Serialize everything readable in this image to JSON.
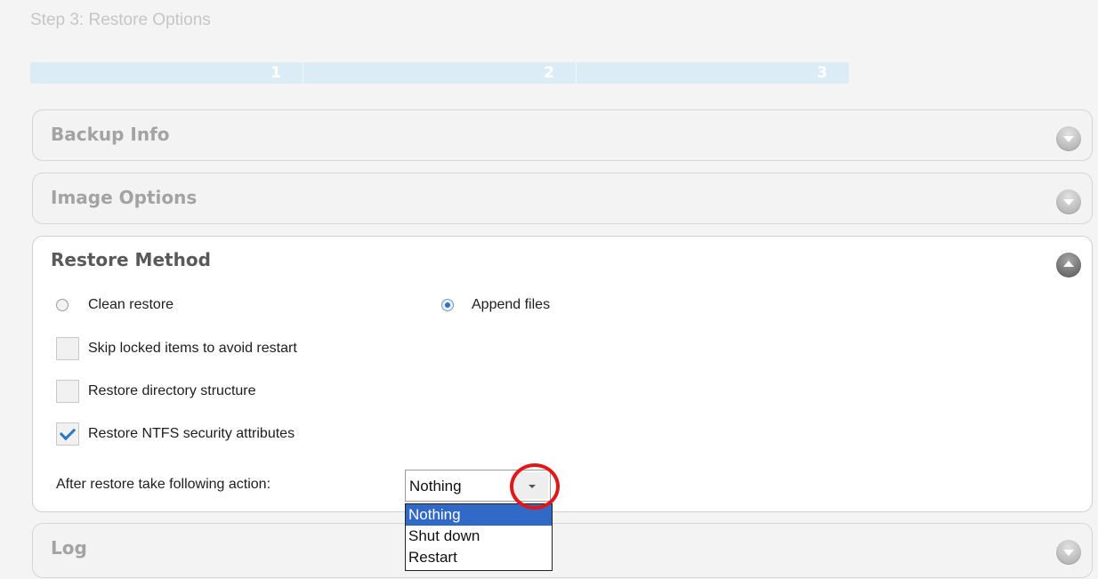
{
  "header": {
    "step_title": "Step 3: Restore Options"
  },
  "progress": {
    "steps": [
      "1",
      "2",
      "3"
    ],
    "current_step": 3
  },
  "panels": {
    "backup_info": {
      "title": "Backup Info",
      "expanded": false
    },
    "image_options": {
      "title": "Image Options",
      "expanded": false
    },
    "restore_method": {
      "title": "Restore Method",
      "expanded": true,
      "restore_mode": {
        "clean_restore_label": "Clean restore",
        "append_files_label": "Append files",
        "selected": "Append files"
      },
      "options": [
        {
          "label": "Skip locked items to avoid restart",
          "checked": false
        },
        {
          "label": "Restore directory structure",
          "checked": false
        },
        {
          "label": "Restore NTFS security attributes",
          "checked": true
        }
      ],
      "after_action": {
        "label": "After restore take following action:",
        "value": "Nothing",
        "options": [
          "Nothing",
          "Shut down",
          "Restart"
        ],
        "highlighted_option": "Nothing"
      }
    },
    "log": {
      "title": "Log",
      "expanded": false
    }
  },
  "colors": {
    "accent": "#3169c6",
    "annotation_circle": "#e01818",
    "progress_bar": "#dcecf6",
    "checkmark": "#2f74c8"
  },
  "icons": {
    "panel_toggle_collapsed": "chevron-down-icon",
    "panel_toggle_expanded": "chevron-up-icon",
    "dropdown_arrow": "dropdown-arrow-icon"
  }
}
